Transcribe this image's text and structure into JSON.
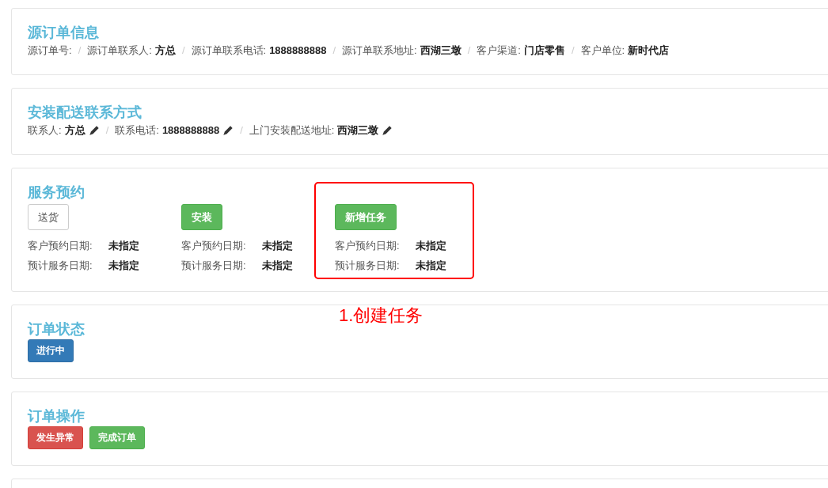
{
  "source_order": {
    "title": "源订单信息",
    "separator": "/",
    "fields": [
      {
        "label": "源订单号:",
        "editable": false
      },
      {
        "label": "源订单联系人:",
        "value": "方总",
        "editable": false
      },
      {
        "label": "源订单联系电话:",
        "value": "1888888888",
        "editable": false
      },
      {
        "label": "源订单联系地址:",
        "value": "西湖三墩",
        "editable": false
      },
      {
        "label": "客户渠道:",
        "value": "门店零售",
        "editable": false
      },
      {
        "label": "客户单位:",
        "value": "新时代店",
        "editable": false
      }
    ]
  },
  "delivery_contact": {
    "title": "安装配送联系方式",
    "separator": "/",
    "fields": [
      {
        "label": "联系人:",
        "value": "方总",
        "editable": true
      },
      {
        "label": "联系电话:",
        "value": "1888888888",
        "editable": true
      },
      {
        "label": "上门安装配送地址:",
        "value": "西湖三墩",
        "editable": true
      }
    ]
  },
  "service_booking": {
    "title": "服务预约",
    "services": [
      {
        "button": {
          "label": "送货",
          "kind": "default"
        },
        "highlighted": false,
        "rows": [
          {
            "label": "客户预约日期:",
            "value": "未指定"
          },
          {
            "label": "预计服务日期:",
            "value": "未指定"
          }
        ]
      },
      {
        "button": {
          "label": "安装",
          "kind": "success"
        },
        "highlighted": false,
        "rows": [
          {
            "label": "客户预约日期:",
            "value": "未指定"
          },
          {
            "label": "预计服务日期:",
            "value": "未指定"
          }
        ]
      },
      {
        "button": {
          "label": "新增任务",
          "kind": "success"
        },
        "highlighted": true,
        "note": "1.创建任务",
        "rows": [
          {
            "label": "客户预约日期:",
            "value": "未指定"
          },
          {
            "label": "预计服务日期:",
            "value": "未指定"
          }
        ]
      }
    ]
  },
  "order_status": {
    "title": "订单状态",
    "badge": {
      "label": "进行中",
      "kind": "primary"
    }
  },
  "order_actions": {
    "title": "订单操作",
    "buttons": [
      {
        "label": "发生异常",
        "kind": "danger"
      },
      {
        "label": "完成订单",
        "kind": "success"
      }
    ]
  }
}
